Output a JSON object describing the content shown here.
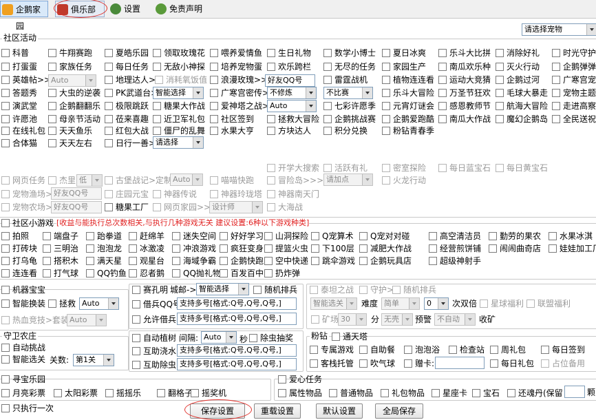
{
  "tabs": [
    "企鹅家园",
    "俱乐部",
    "设置",
    "免责声明"
  ],
  "top_select": "请选择宠物",
  "community": {
    "title": "社区活动",
    "rows": [
      [
        "科普",
        "牛翔赛跑",
        "夏皓乐园",
        "领取玫瑰花",
        "喂养爱情鱼",
        "生日礼物",
        "数学小博士",
        "夏日冰爽",
        "乐斗大比拼",
        "消除好礼",
        "时光守护"
      ],
      [
        "打蛋蛋",
        "家族任务",
        "每日任务",
        "无敌小神探",
        "培养宠物蛋",
        "欢乐跨栏",
        "无尽的任务",
        "家园生产",
        "南瓜欢乐种",
        "灭火行动",
        "企鹅弹弹"
      ],
      [
        "英雄帖>>",
        "",
        "地理达人>",
        "消耗氧饭值",
        "浪漫玫瑰>>",
        "",
        "雷霆战机",
        "植物连连看",
        "运动大竞猜",
        "企鹅过河",
        "广寒宫宠"
      ],
      [
        "答题秀",
        "大虫的逆袭",
        "PK武道台>",
        "",
        "广寒宫密传>",
        "",
        "",
        "乐斗大冒险",
        "万圣节狂欢",
        "毛球大暴走",
        "宠物主题"
      ],
      [
        "演武堂",
        "企鹅翻翻乐",
        "极限跳跃",
        "糖果大作战",
        "爱神塔之战>",
        "",
        "七彩许愿季",
        "元宵灯谜会",
        "感恩教师节",
        "航海大冒险",
        "走进高察"
      ],
      [
        "许愿池",
        "母亲节活动",
        "莅来喜趣",
        "近卫军礼包",
        "社区签到",
        "拯救大冒险",
        "企鹅挑战赛",
        "企鹅爱跑酷",
        "南瓜大作战",
        "魔幻企鹅岛",
        "全民送祝"
      ],
      [
        "在线礼包",
        "天天鱼乐",
        "红包大战",
        "僵尸的乱舞",
        "水果大亨",
        "方块达人",
        "积分兑换",
        "粉钻青春季"
      ],
      [
        "合体猫",
        "天天左右",
        "日行一善>>"
      ]
    ],
    "row3_select": "Auto",
    "row3_input": "好友QQ号",
    "row4_select1": "智能选择",
    "row4_select2": "不修炼",
    "row4_select3": "不比赛",
    "row5_select": "Auto",
    "row8_select": "请选择"
  },
  "disabled_area": {
    "row1": [
      "开学大搜索",
      "活跃有礼",
      "密室探险",
      "每日蓝宝石",
      "每日黄宝石"
    ],
    "row2": [
      "网页任务",
      "杰里",
      "古堡战记>定制",
      "喵喵快跑",
      "冒险岛>>>",
      "火龙行动"
    ],
    "row2_select1": "低",
    "row2_select2": "Auto",
    "row2_select3": "请加点",
    "row3": [
      "宠物渔场>",
      "庄园元宝",
      "神器传说",
      "神器玲珑塔",
      "神器南天门"
    ],
    "row3_input": "好友QQ号",
    "row4": [
      "宠物农场>",
      "糖果工厂",
      "网页家园>>",
      "大海战"
    ],
    "row4_input": "好友QQ号",
    "row4_select": "设计师"
  },
  "mini_games": {
    "title": "社区小游戏",
    "note": "[收益与能执行总次数相关,与执行几种游戏无关 建议设置:6种以下游戏种类]",
    "rows": [
      [
        "拍照",
        "端盘子",
        "跆拳道",
        "赶绵羊",
        "迷失空间",
        "好好学习",
        "山洞探险",
        "Q宠算术",
        "Q宠对对碰",
        "高空清洁员",
        "勤劳的果农",
        "水果冰淇"
      ],
      [
        "打砖块",
        "三明治",
        "泡泡龙",
        "冰激凌",
        "冲浪游戏",
        "疯狂变身",
        "提篮火虫",
        "下100层",
        "减肥大作战",
        "经营煎饼铺",
        "闹闹曲奇店",
        "娃娃加工厂"
      ],
      [
        "打乌龟",
        "搭积木",
        "满天星",
        "观星台",
        "海域争霸",
        "企鹅快跑",
        "空中快递",
        "跳伞游戏",
        "企鹅玩具店",
        "超级神射手"
      ],
      [
        "连连看",
        "打气球",
        "QQ钓鱼",
        "忍者鹅",
        "QQ抛礼物",
        "百发百中",
        "扔炸弹"
      ]
    ]
  },
  "robot": {
    "title": "机器宝宝",
    "smart_swap": "智能换装",
    "rescue": "拯救",
    "rescue_select": "Auto",
    "arena": "热血竞技>套装",
    "arena_select": "Auto"
  },
  "confucius": {
    "label": "赛孔明",
    "city": "城邮->",
    "city_select": "智能选择",
    "random": "随机排兵",
    "borrow": "借兵QQ号",
    "borrow_text": "支持多号[格式:Q号,Q号,Q号,]",
    "allow_borrow": "允许借兵",
    "allow_borrow_text": "支持多号[格式:Q号,Q号,Q号,]"
  },
  "taiba": {
    "items": [
      "泰坦之战",
      "守护>",
      "随机排兵"
    ],
    "smart_select": "智能选关",
    "difficulty": "难度",
    "difficulty_select": "简单",
    "times_select": "0",
    "times_label": "次双倍",
    "star": "星球福利",
    "league": "联盟福利",
    "mine": "矿场",
    "mine_select": "30",
    "mine_unit": "分",
    "mine_select2": "无壳",
    "warn": "预警",
    "warn_select": "不自动",
    "harvest": "收矿"
  },
  "garden": {
    "title": "守卫农庄",
    "auto_challenge": "自动挑战",
    "smart_level": "智能选关",
    "level_label": "关数:",
    "level_select": "第1关"
  },
  "plant": {
    "auto_plant": "自动植树",
    "interval": "间隔:",
    "interval_select": "Auto",
    "seconds": "秒",
    "pest": "除虫抽奖",
    "water": "互助浇水",
    "water_text": "支持多号[格式:Q号,Q号,Q号,]",
    "weed": "互助除虫",
    "weed_text": "支持多号[格式:Q号,Q号,Q号,]"
  },
  "pink": {
    "title": "粉钻",
    "tower": "通天塔",
    "row1": [
      "专属游戏",
      "自助餐",
      "泡泡浴",
      "检查站",
      "周礼包",
      "每日签到"
    ],
    "row2": [
      "客栈托管",
      "吹气球",
      "赠卡:"
    ],
    "row2_right": [
      "每日礼包",
      "占位备用"
    ]
  },
  "treasure": {
    "title": "寻宝乐园",
    "items": [
      "月亮彩票",
      "太阳彩票",
      "摇摇乐",
      "翻格子",
      "摇奖机"
    ]
  },
  "love": {
    "title": "爱心任务",
    "items": [
      "属性物品",
      "普通物品",
      "礼包物品",
      "星座卡",
      "宝石",
      "还魂丹(保留"
    ],
    "unit": "颗"
  },
  "bottom": {
    "once": "只执行一次",
    "save": "保存设置",
    "reload": "重载设置",
    "default": "默认设置",
    "save_all": "全局保存"
  }
}
